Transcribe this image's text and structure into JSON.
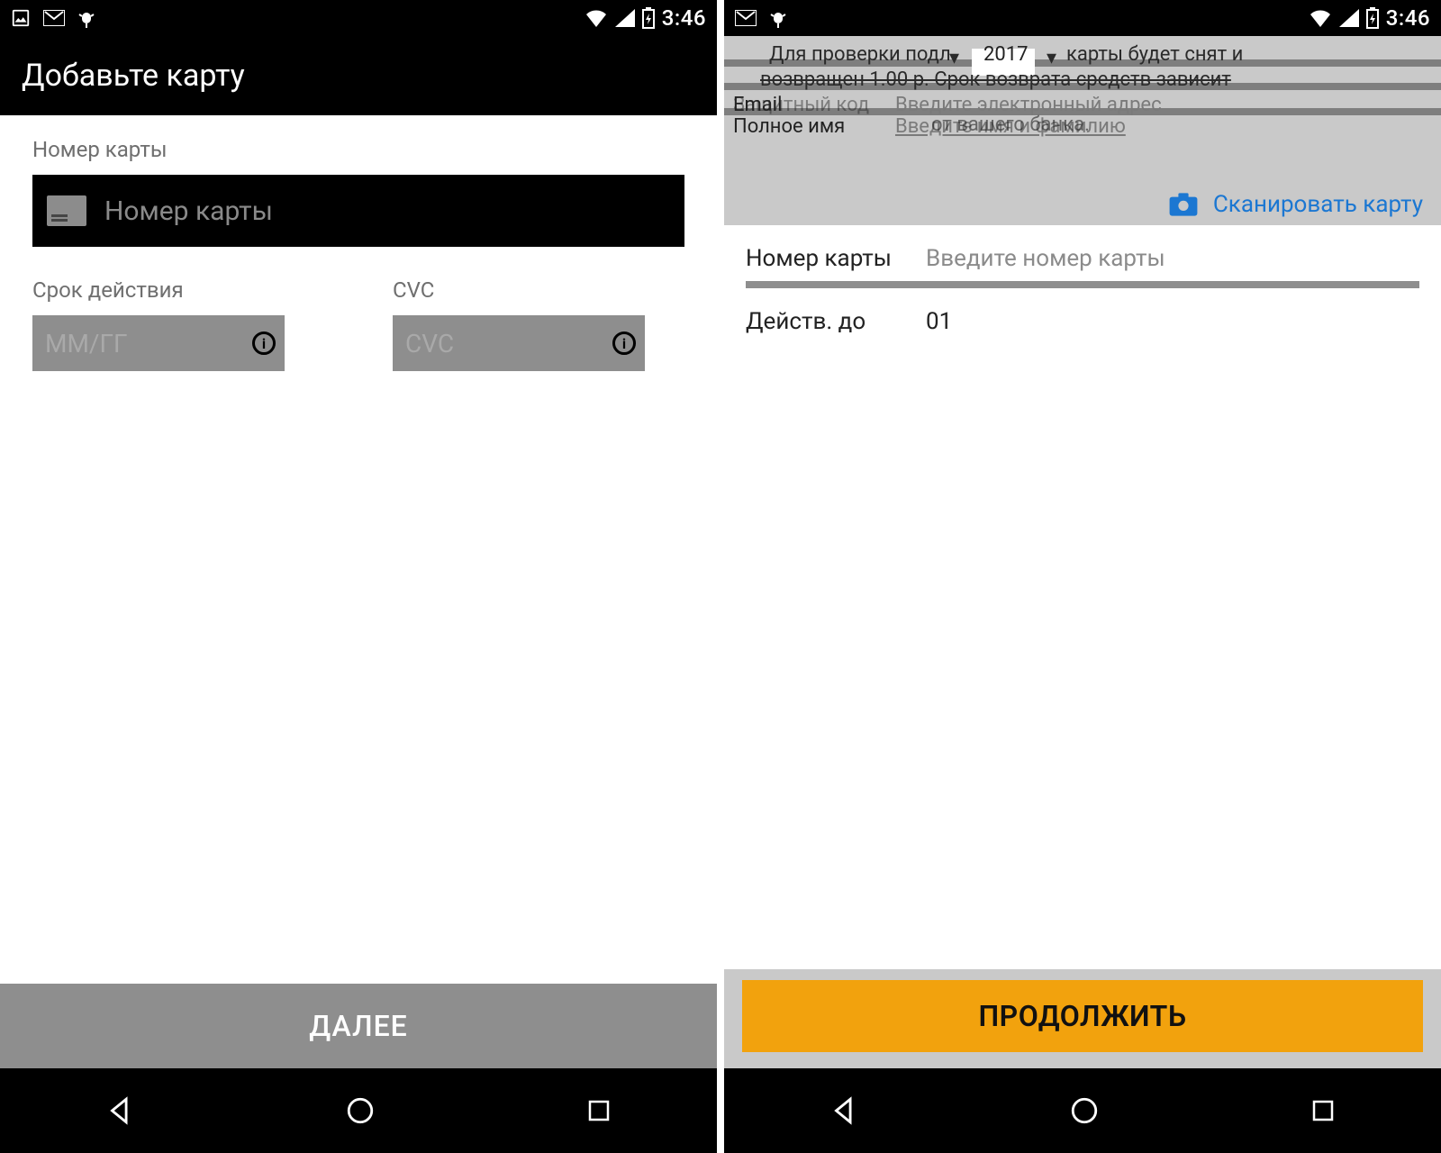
{
  "status": {
    "time": "3:46"
  },
  "left": {
    "title": "Добавьте карту",
    "card_number_label": "Номер карты",
    "card_number_placeholder": "Номер карты",
    "expiry_label": "Срок действия",
    "expiry_placeholder": "ММ/ГГ",
    "cvc_label": "CVC",
    "cvc_placeholder": "CVC",
    "next_button": "ДАЛЕЕ"
  },
  "right": {
    "glitch": {
      "line1_left": "Для проверки подл",
      "line1_mid": "2017",
      "line1_right": "карты будет снят и",
      "line2": "возвращен 1.00 р. Срок возврата средств зависит",
      "email_label": "Email",
      "email_placeholder": "Введите электронный адрес",
      "secure_label": "Защитный код",
      "bank_text": "от вашего банка.",
      "name_label": "Полное имя",
      "name_placeholder": "Введите имя и фамилию",
      "scan_label": "Сканировать карту"
    },
    "card_number_label": "Номер карты",
    "card_number_placeholder": "Введите номер карты",
    "valid_label": "Действ. до",
    "valid_value": "01",
    "continue_button": "ПРОДОЛЖИТЬ"
  }
}
